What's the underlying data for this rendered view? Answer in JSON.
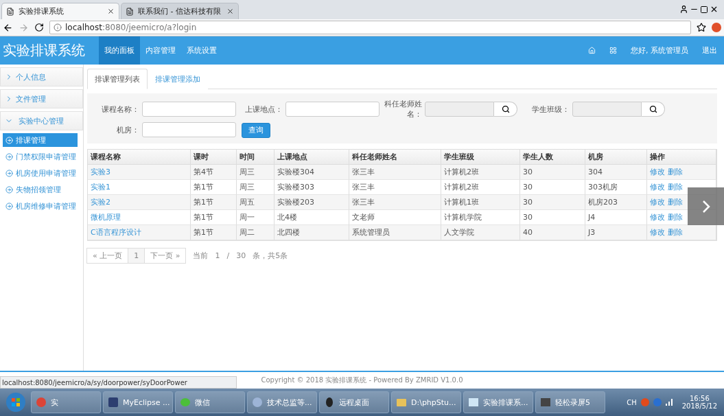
{
  "browser": {
    "tabs": [
      {
        "title": "实验排课系统",
        "selected": true
      },
      {
        "title": "联系我们 - 信达科技有限",
        "selected": false
      }
    ],
    "address": {
      "host": "localhost",
      "path": ":8080/jeemicro/a?login"
    }
  },
  "header": {
    "brand": "实验排课系统",
    "nav": [
      {
        "label": "我的面板",
        "selected": true
      },
      {
        "label": "内容管理",
        "selected": false
      },
      {
        "label": "系统设置",
        "selected": false
      }
    ],
    "greeting": "您好, 系统管理员",
    "logout": "退出"
  },
  "sidebar": [
    {
      "label": "个人信息",
      "expanded": false
    },
    {
      "label": "文件管理",
      "expanded": false
    },
    {
      "label": "实验中心管理",
      "expanded": true,
      "children": [
        {
          "label": "排课管理",
          "selected": true
        },
        {
          "label": "门禁权限申请管理",
          "selected": false
        },
        {
          "label": "机房使用申请管理",
          "selected": false
        },
        {
          "label": "失物招领管理",
          "selected": false
        },
        {
          "label": "机房维修申请管理",
          "selected": false
        }
      ]
    }
  ],
  "content_tabs": [
    {
      "label": "排课管理列表",
      "selected": true
    },
    {
      "label": "排课管理添加",
      "selected": false
    }
  ],
  "filters": [
    {
      "label": "课程名称：",
      "kind": "text"
    },
    {
      "label": "上课地点：",
      "kind": "text"
    },
    {
      "label": "科任老师姓名：",
      "kind": "search"
    },
    {
      "label": "学生班级：",
      "kind": "search"
    },
    {
      "label": "机房：",
      "kind": "text"
    }
  ],
  "query_button": "查询",
  "table": {
    "columns": [
      "课程名称",
      "课时",
      "时间",
      "上课地点",
      "科任老师姓名",
      "学生班级",
      "学生人数",
      "机房",
      "操作"
    ],
    "rows": [
      {
        "cells": [
          "实验3",
          "第4节",
          "周三",
          "实验楼304",
          "张三丰",
          "计算机2班",
          "30",
          "304"
        ],
        "actions": [
          "修改",
          "删除"
        ]
      },
      {
        "cells": [
          "实验1",
          "第1节",
          "周三",
          "实验楼303",
          "张三丰",
          "计算机2班",
          "30",
          "303机房"
        ],
        "actions": [
          "修改",
          "删除"
        ]
      },
      {
        "cells": [
          "实验2",
          "第1节",
          "周五",
          "实验楼203",
          "张三丰",
          "计算机1班",
          "30",
          "机房203"
        ],
        "actions": [
          "修改",
          "删除"
        ]
      },
      {
        "cells": [
          "微机原理",
          "第1节",
          "周一",
          "北4楼",
          "文老师",
          "计算机学院",
          "30",
          "J4"
        ],
        "actions": [
          "修改",
          "删除"
        ]
      },
      {
        "cells": [
          "C语言程序设计",
          "第1节",
          "周二",
          "北四楼",
          "系统管理员",
          "人文学院",
          "40",
          "J3"
        ],
        "actions": [
          "修改",
          "删除"
        ]
      }
    ]
  },
  "pagination": {
    "prev": "« 上一页",
    "pages": [
      {
        "label": "1"
      }
    ],
    "next": "下一页 »",
    "info": [
      "当前",
      "1",
      "/",
      "30",
      "条，共5条"
    ]
  },
  "footer": "Copyright © 2018 实验排课系统 - Powered By ZMRID V1.0.0",
  "status_url": "localhost:8080/jeemicro/a/sy/doorpower/syDoorPower",
  "taskbar": {
    "items": [
      {
        "label": "实"
      },
      {
        "label": "MyEclipse ..."
      },
      {
        "label": "微信"
      },
      {
        "label": "技术总监等..."
      },
      {
        "label": "远程桌面"
      },
      {
        "label": "D:\\phpStu..."
      },
      {
        "label": "实验排课系..."
      },
      {
        "label": "轻松录屏5"
      }
    ],
    "lang": "CH",
    "time": "16:56",
    "date": "2018/5/12"
  }
}
